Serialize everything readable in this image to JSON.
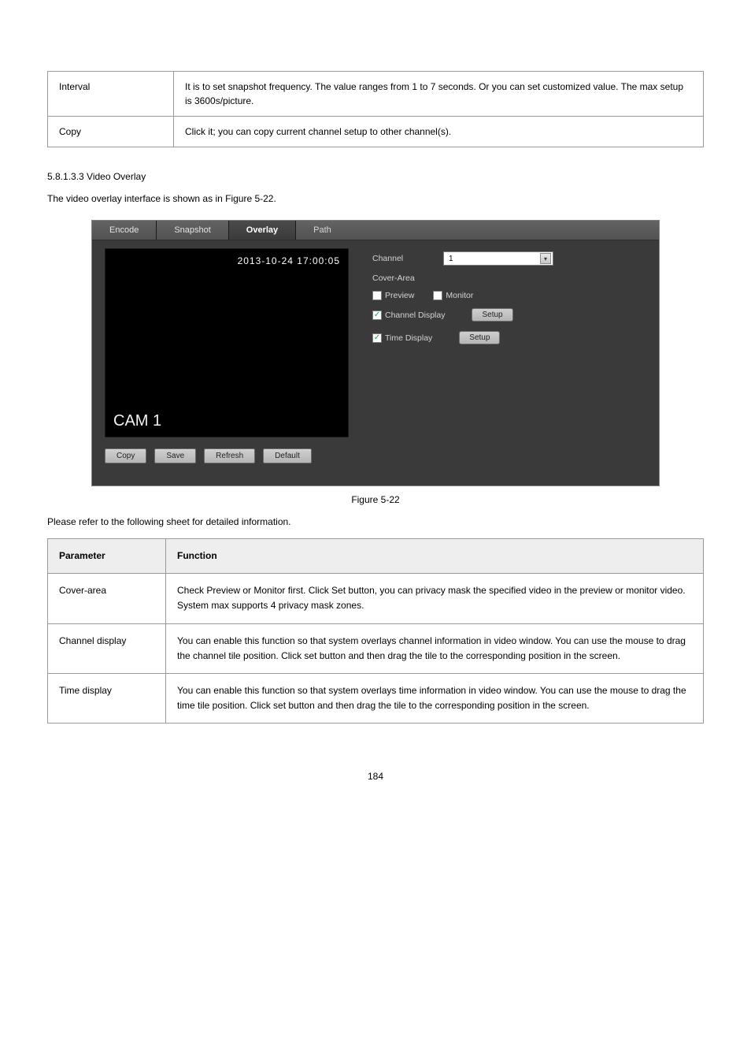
{
  "top_table": {
    "rows": [
      {
        "param": "Interval",
        "desc": "It is to set snapshot frequency. The value ranges from 1 to 7 seconds. Or you can set customized value. The max setup is 3600s/picture."
      },
      {
        "param": "Copy",
        "desc": "Click it; you can copy current channel setup to other channel(s)."
      }
    ]
  },
  "section": {
    "heading": "5.8.1.3.3 Video Overlay",
    "intro": "The video overlay interface is shown as in Figure 5-22."
  },
  "figure": {
    "tabs": {
      "encode": "Encode",
      "snapshot": "Snapshot",
      "overlay": "Overlay",
      "path": "Path"
    },
    "preview": {
      "timestamp": "2013-10-24 17:00:05",
      "cam": "CAM 1"
    },
    "bottom_buttons": {
      "copy": "Copy",
      "save": "Save",
      "refresh": "Refresh",
      "def": "Default"
    },
    "controls": {
      "channel_label": "Channel",
      "channel_value": "1",
      "cover_area": "Cover-Area",
      "preview": "Preview",
      "monitor": "Monitor",
      "channel_display": "Channel Display",
      "time_display": "Time Display",
      "setup": "Setup"
    },
    "caption": "Figure 5-22"
  },
  "lead_text": "Please refer to the following sheet for detailed information.",
  "bottom_table": {
    "head": {
      "param": "Parameter",
      "func": "Function"
    },
    "rows": [
      {
        "param": "Cover-area",
        "func": "Check Preview or Monitor first. Click Set button, you can privacy mask the specified video in the preview or monitor video. System max supports 4 privacy mask zones."
      },
      {
        "param": "Channel display",
        "func": "You can enable this function so that system overlays channel information in video window. You can use the mouse to drag the channel tile position. Click set button and then drag the tile to the corresponding position in the screen."
      },
      {
        "param": "Time display",
        "func": "You can enable this function so that system overlays time information in video window. You can use the mouse to drag the time tile position. Click set button and then drag the tile to the corresponding position in the screen."
      }
    ]
  },
  "page_number": "184"
}
